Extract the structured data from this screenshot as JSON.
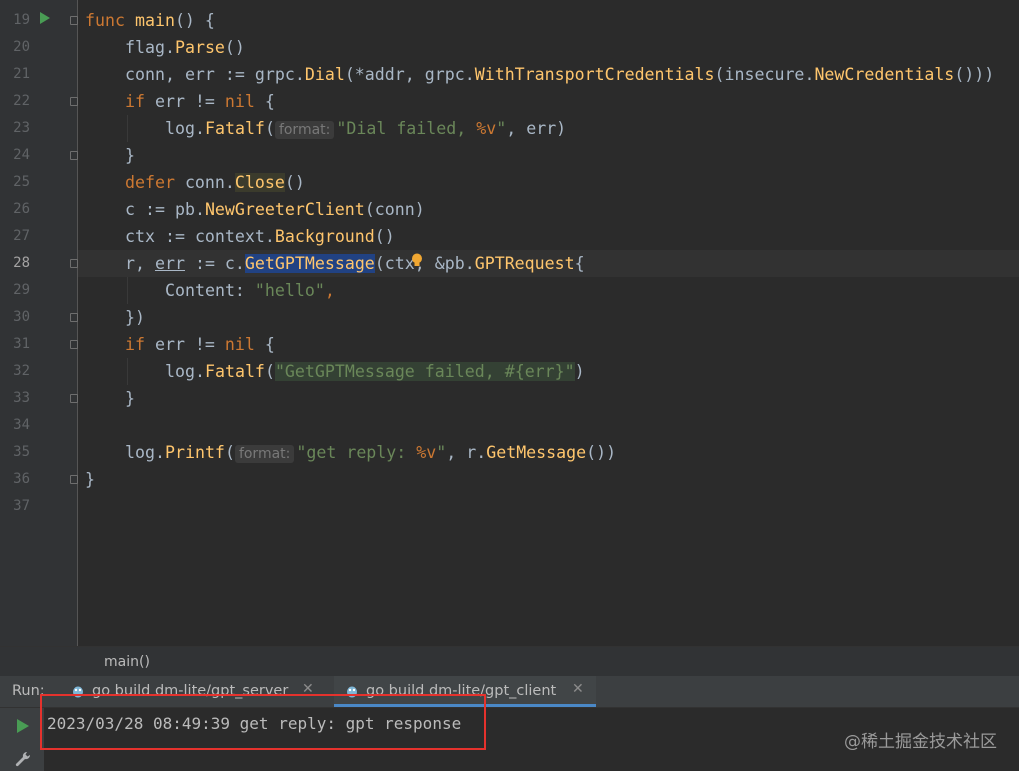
{
  "editor": {
    "current_line": "28",
    "line_numbers": [
      "19",
      "20",
      "21",
      "22",
      "23",
      "24",
      "25",
      "26",
      "27",
      "28",
      "29",
      "30",
      "31",
      "32",
      "33",
      "34",
      "35",
      "36",
      "37"
    ],
    "tokens": {
      "l19": [
        "func",
        "main",
        "() {"
      ],
      "l20": [
        "flag",
        ".",
        "Parse",
        "()"
      ],
      "l21": [
        "conn, err := ",
        "grpc",
        ".",
        "Dial",
        "(*addr, ",
        "grpc",
        ".",
        "WithTransportCredentials",
        "(",
        "insecure",
        ".",
        "NewCredentials",
        "()))"
      ],
      "l22": [
        "if",
        " err != ",
        "nil",
        " {"
      ],
      "l23": [
        "log",
        ".",
        "Fatalf",
        "(",
        "format:",
        "\"Dial failed, ",
        "%v",
        "\"",
        ", err)"
      ],
      "l24": [
        "}"
      ],
      "l25": [
        "defer",
        " conn.",
        "Close",
        "()"
      ],
      "l26": [
        "c := ",
        "pb",
        ".",
        "NewGreeterClient",
        "(conn)"
      ],
      "l27": [
        "ctx := ",
        "context",
        ".",
        "Background",
        "()"
      ],
      "l28": [
        "r, ",
        "err",
        " := c.",
        "GetGPTMessage",
        "(ctx, &",
        "pb",
        ".",
        "GPTRequest",
        "{"
      ],
      "l29": [
        "Content: ",
        "\"hello\"",
        ","
      ],
      "l30": [
        "})"
      ],
      "l31": [
        "if",
        " err != ",
        "nil",
        " {"
      ],
      "l32": [
        "log",
        ".",
        "Fatalf",
        "(",
        "\"GetGPTMessage failed, #{err}\"",
        ")"
      ],
      "l33": [
        "}"
      ],
      "l34": [
        ""
      ],
      "l35": [
        "log",
        ".",
        "Printf",
        "(",
        "format:",
        "\"get reply: ",
        "%v",
        "\"",
        ", r.",
        "GetMessage",
        "())"
      ],
      "l36": [
        "}"
      ]
    }
  },
  "breadcrumb": {
    "label": "main()"
  },
  "run_panel": {
    "label": "Run:",
    "tabs": [
      {
        "label": "go build dm-lite/gpt_server",
        "active": false
      },
      {
        "label": "go build dm-lite/gpt_client",
        "active": true
      }
    ],
    "output": "2023/03/28 08:49:39 get reply: gpt response"
  },
  "watermark": "@稀土掘金技术社区",
  "colors": {
    "keyword": "#cc7832",
    "function": "#ffc66d",
    "string": "#6a8759",
    "plain": "#a9b7c6",
    "background": "#2b2b2b",
    "highlight_box": "#e5322d"
  },
  "icons": [
    "run-gutter-icon",
    "fold-marker-icon",
    "lightbulb-icon",
    "gopher-icon",
    "close-icon",
    "rerun-icon",
    "wrench-icon"
  ]
}
